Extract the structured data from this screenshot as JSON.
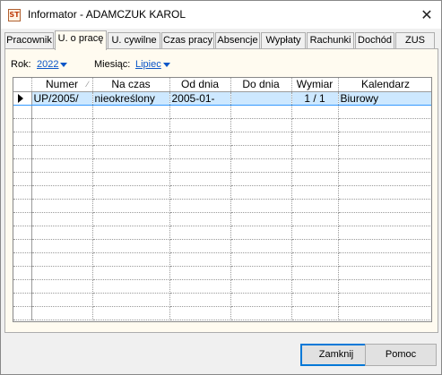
{
  "window": {
    "icon": "app-logo-icon",
    "icon_text": "ST",
    "title": "Informator - ADAMCZUK KAROL",
    "close_glyph": "✕"
  },
  "tabs": [
    {
      "label": "Pracownik",
      "active": false
    },
    {
      "label": "U. o pracę",
      "active": true
    },
    {
      "label": "U. cywilne",
      "active": false
    },
    {
      "label": "Czas pracy",
      "active": false
    },
    {
      "label": "Absencje",
      "active": false
    },
    {
      "label": "Wypłaty",
      "active": false
    },
    {
      "label": "Rachunki",
      "active": false
    },
    {
      "label": "Dochód",
      "active": false
    },
    {
      "label": "ZUS",
      "active": false
    }
  ],
  "filters": {
    "year_label": "Rok:",
    "year_value": "2022",
    "month_label": "Miesiąc:",
    "month_value": "Lipiec"
  },
  "grid": {
    "columns": [
      "Numer",
      "Na czas",
      "Od dnia",
      "Do dnia",
      "Wymiar",
      "Kalendarz"
    ],
    "sort_indicator": "∕",
    "rows": [
      [
        "UP/2005/",
        "nieokreślony",
        "2005-01-",
        "",
        "1 / 1",
        "Biurowy"
      ]
    ]
  },
  "buttons": {
    "close": "Zamknij",
    "help": "Pomoc"
  },
  "colors": {
    "link": "#0a56c8",
    "selection": "#cde8ff",
    "default_button_border": "#0078d7"
  }
}
